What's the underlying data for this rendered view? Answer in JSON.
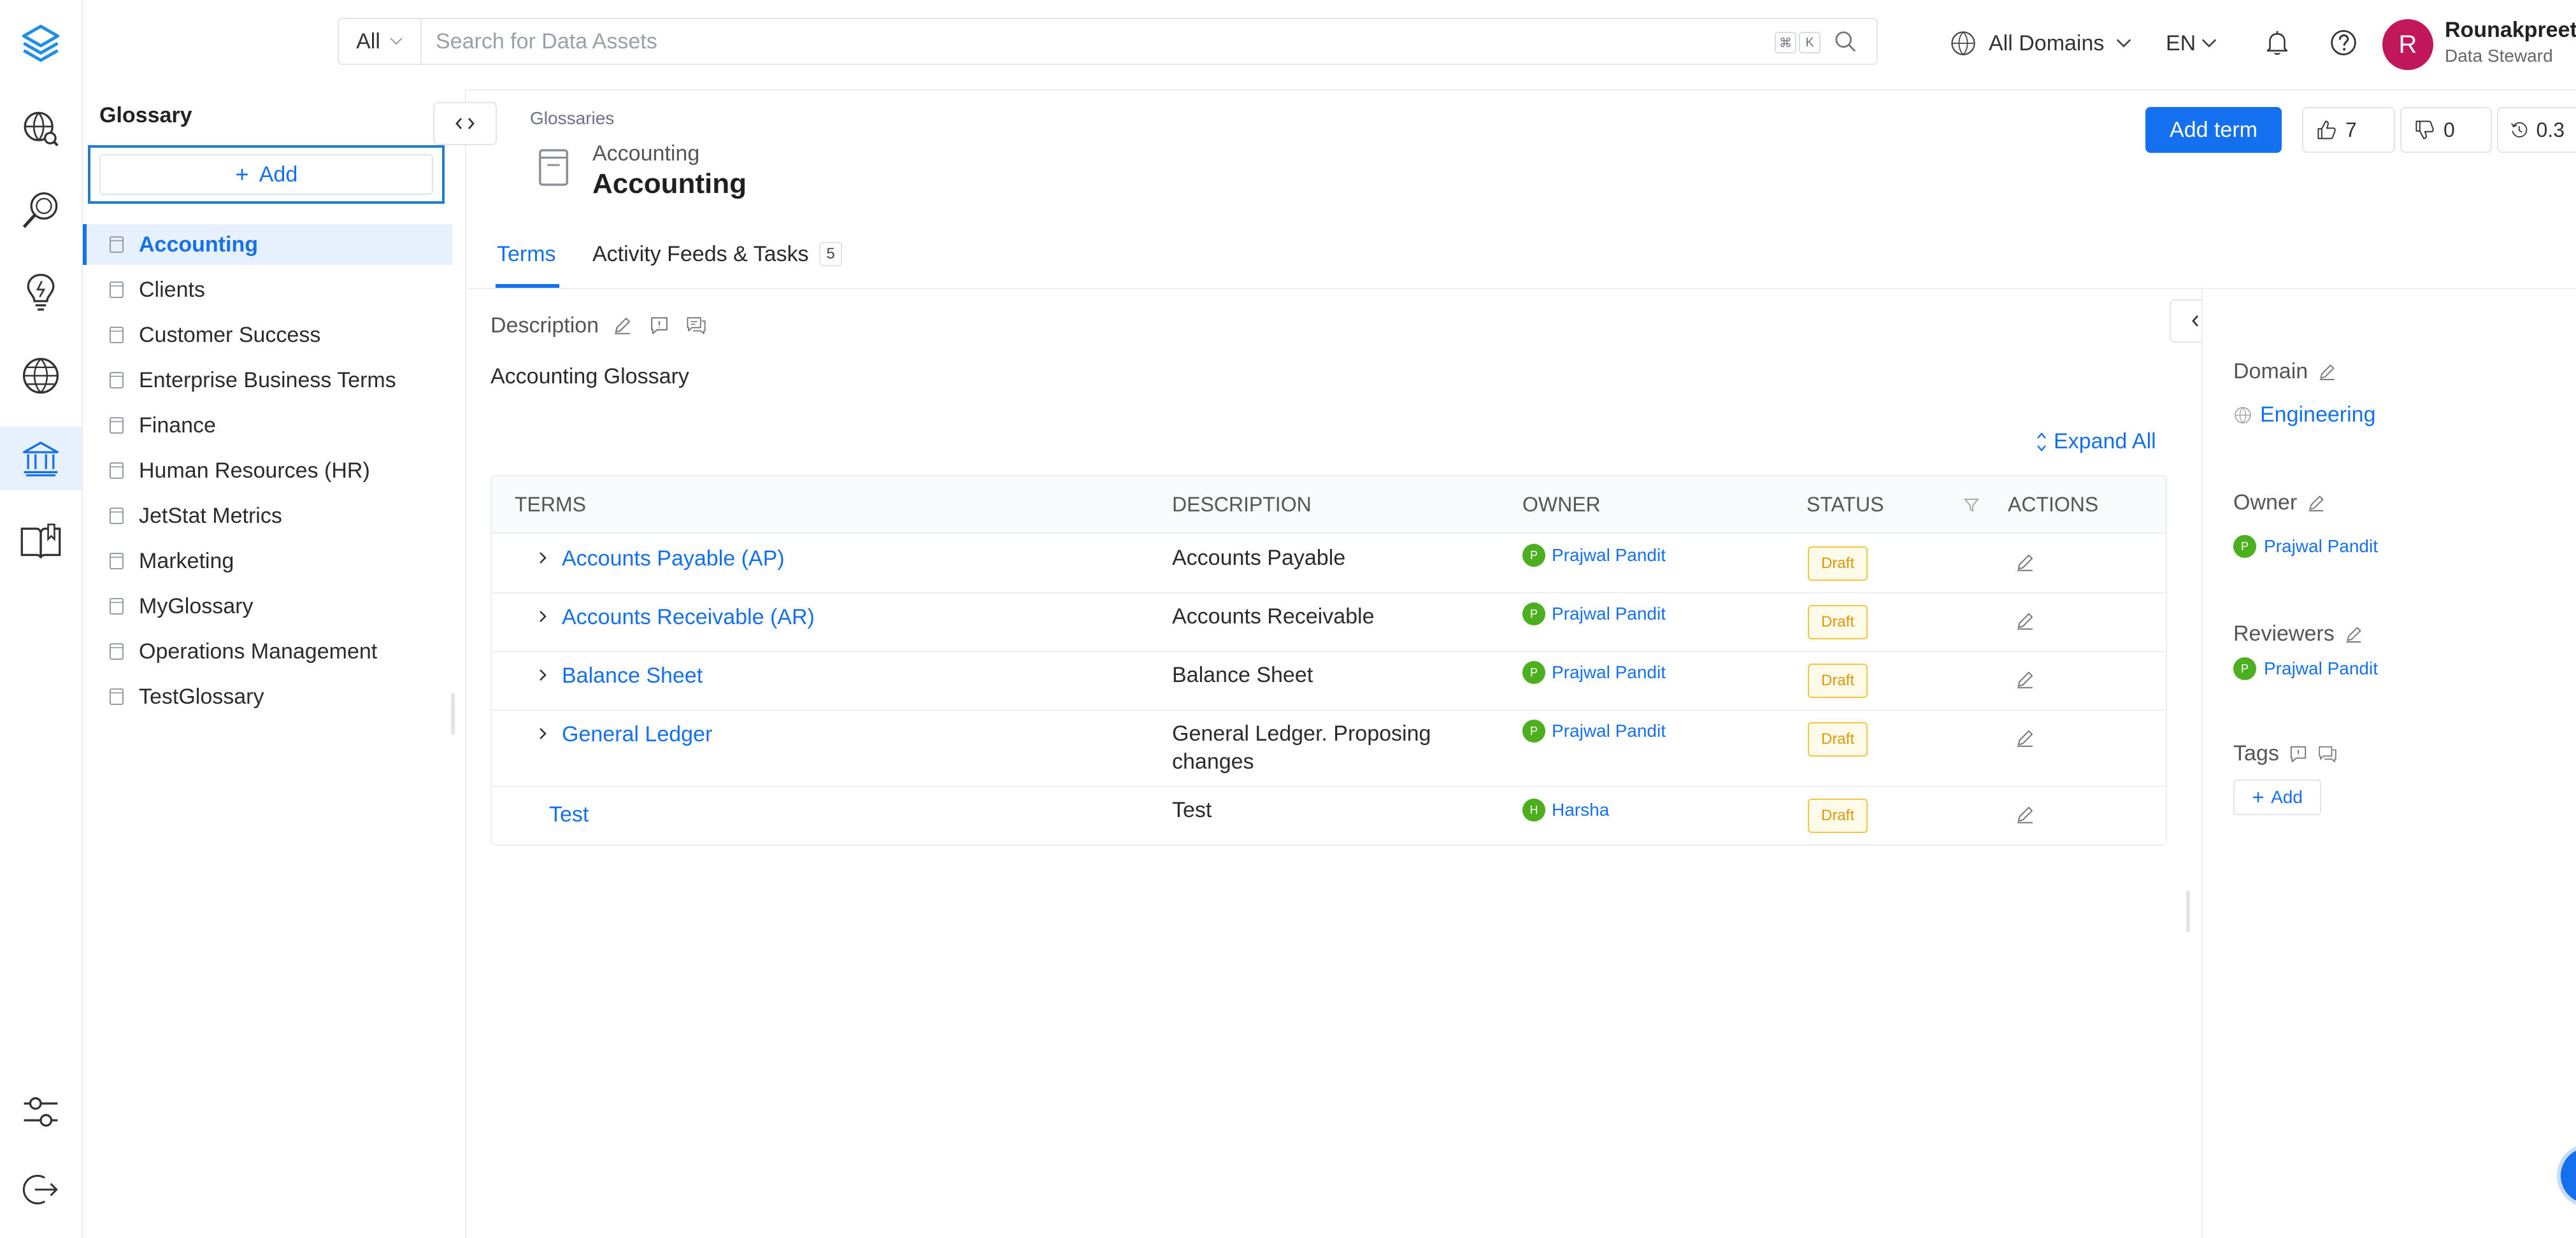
{
  "app": {
    "colors": {
      "accent": "#1570ef",
      "draft_border": "#f5c542",
      "draft_text": "#e29700",
      "avatar_green": "#4caf1f",
      "user_avatar": "#c2185b"
    }
  },
  "rail": {
    "icons": [
      "explore-icon",
      "data-quality-icon",
      "insights-icon",
      "domains-icon",
      "governance-icon",
      "knowledge-center-icon",
      "settings-icon",
      "logout-icon"
    ]
  },
  "header": {
    "search": {
      "scope": "All",
      "placeholder": "Search for Data Assets",
      "kbd_cmd": "⌘",
      "kbd_key": "K"
    },
    "domains_label": "All Domains",
    "language": "EN",
    "user": {
      "initial": "R",
      "name": "Rounakpreet.",
      "role": "Data Steward"
    }
  },
  "glossary_panel": {
    "title": "Glossary",
    "add_label": "Add",
    "items": [
      {
        "label": "Accounting",
        "active": true
      },
      {
        "label": "Clients"
      },
      {
        "label": "Customer Success"
      },
      {
        "label": "Enterprise Business Terms"
      },
      {
        "label": "Finance"
      },
      {
        "label": "Human Resources (HR)"
      },
      {
        "label": "JetStat Metrics"
      },
      {
        "label": "Marketing"
      },
      {
        "label": "MyGlossary"
      },
      {
        "label": "Operations Management"
      },
      {
        "label": "TestGlossary"
      }
    ]
  },
  "main": {
    "breadcrumb": "Glossaries",
    "subtitle": "Accounting",
    "title": "Accounting",
    "add_term_label": "Add term",
    "upvotes": "7",
    "downvotes": "0",
    "version": "0.3",
    "tabs": [
      {
        "label": "Terms"
      },
      {
        "label": "Activity Feeds & Tasks",
        "badge": "5"
      }
    ],
    "description_label": "Description",
    "description": "Accounting Glossary",
    "expand_all_label": "Expand All",
    "table": {
      "headers": {
        "terms": "Terms",
        "description": "Description",
        "owner": "Owner",
        "status": "Status",
        "actions": "Actions"
      },
      "rows": [
        {
          "term": "Accounts Payable (AP)",
          "description": "Accounts Payable",
          "owner": "Prajwal Pandit",
          "owner_initial": "P",
          "status": "Draft"
        },
        {
          "term": "Accounts Receivable (AR)",
          "description": "Accounts Receivable",
          "owner": "Prajwal Pandit",
          "owner_initial": "P",
          "status": "Draft"
        },
        {
          "term": "Balance Sheet",
          "description": "Balance Sheet",
          "owner": "Prajwal Pandit",
          "owner_initial": "P",
          "status": "Draft"
        },
        {
          "term": "General Ledger",
          "description": "General Ledger. Proposing changes",
          "owner": "Prajwal Pandit",
          "owner_initial": "P",
          "status": "Draft"
        },
        {
          "term": "Test",
          "description": "Test",
          "owner": "Harsha",
          "owner_initial": "H",
          "status": "Draft"
        }
      ]
    }
  },
  "right_panel": {
    "domain_label": "Domain",
    "domain_value": "Engineering",
    "owner_label": "Owner",
    "owner_value": "Prajwal Pandit",
    "owner_initial": "P",
    "reviewers_label": "Reviewers",
    "reviewer_value": "Prajwal Pandit",
    "reviewer_initial": "P",
    "tags_label": "Tags",
    "tags_add_label": "Add"
  }
}
